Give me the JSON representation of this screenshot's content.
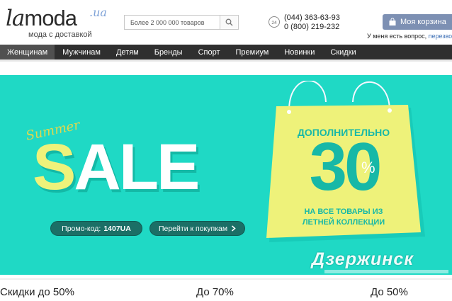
{
  "header": {
    "logo": {
      "main": "lamoda",
      "tld": ".ua",
      "tagline": "мода с доставкой"
    },
    "search": {
      "placeholder": "Более 2 000 000 товаров",
      "icon": "search-icon"
    },
    "phones": [
      "(044) 363-63-93",
      "0 (800) 219-232"
    ],
    "phone_icon_label": "24",
    "cart": {
      "label": "Моя корзина",
      "icon": "bag-icon"
    },
    "help": {
      "text": "У меня есть вопрос,",
      "link": "перезво"
    }
  },
  "nav": {
    "items": [
      {
        "label": "Женщинам",
        "active": true
      },
      {
        "label": "Мужчинам"
      },
      {
        "label": "Детям"
      },
      {
        "label": "Бренды"
      },
      {
        "label": "Спорт"
      },
      {
        "label": "Премиум"
      },
      {
        "label": "Новинки"
      },
      {
        "label": "Скидки"
      }
    ]
  },
  "banner": {
    "summer": "Summer",
    "sale_first": "S",
    "sale_rest": "ALE",
    "promo_label": "Промо-код:",
    "promo_code": "1407UA",
    "cta": "Перейти к покупкам",
    "bag_line1": "ДОПОЛНИТЕЛЬНО",
    "bag_value": "30",
    "bag_unit": "%",
    "bag_line2": "НА ВСЕ ТОВАРЫ ИЗ",
    "bag_line3": "ЛЕТНЕЙ КОЛЛЕКЦИИ",
    "watermark": "Дзержинск",
    "colors": {
      "background": "#1fd9c5",
      "bag": "#eef27a",
      "accent": "#17b8a7",
      "button": "#1b6f66"
    }
  },
  "deals": [
    "Скидки до 50%",
    "До 70%",
    "До 50%"
  ]
}
